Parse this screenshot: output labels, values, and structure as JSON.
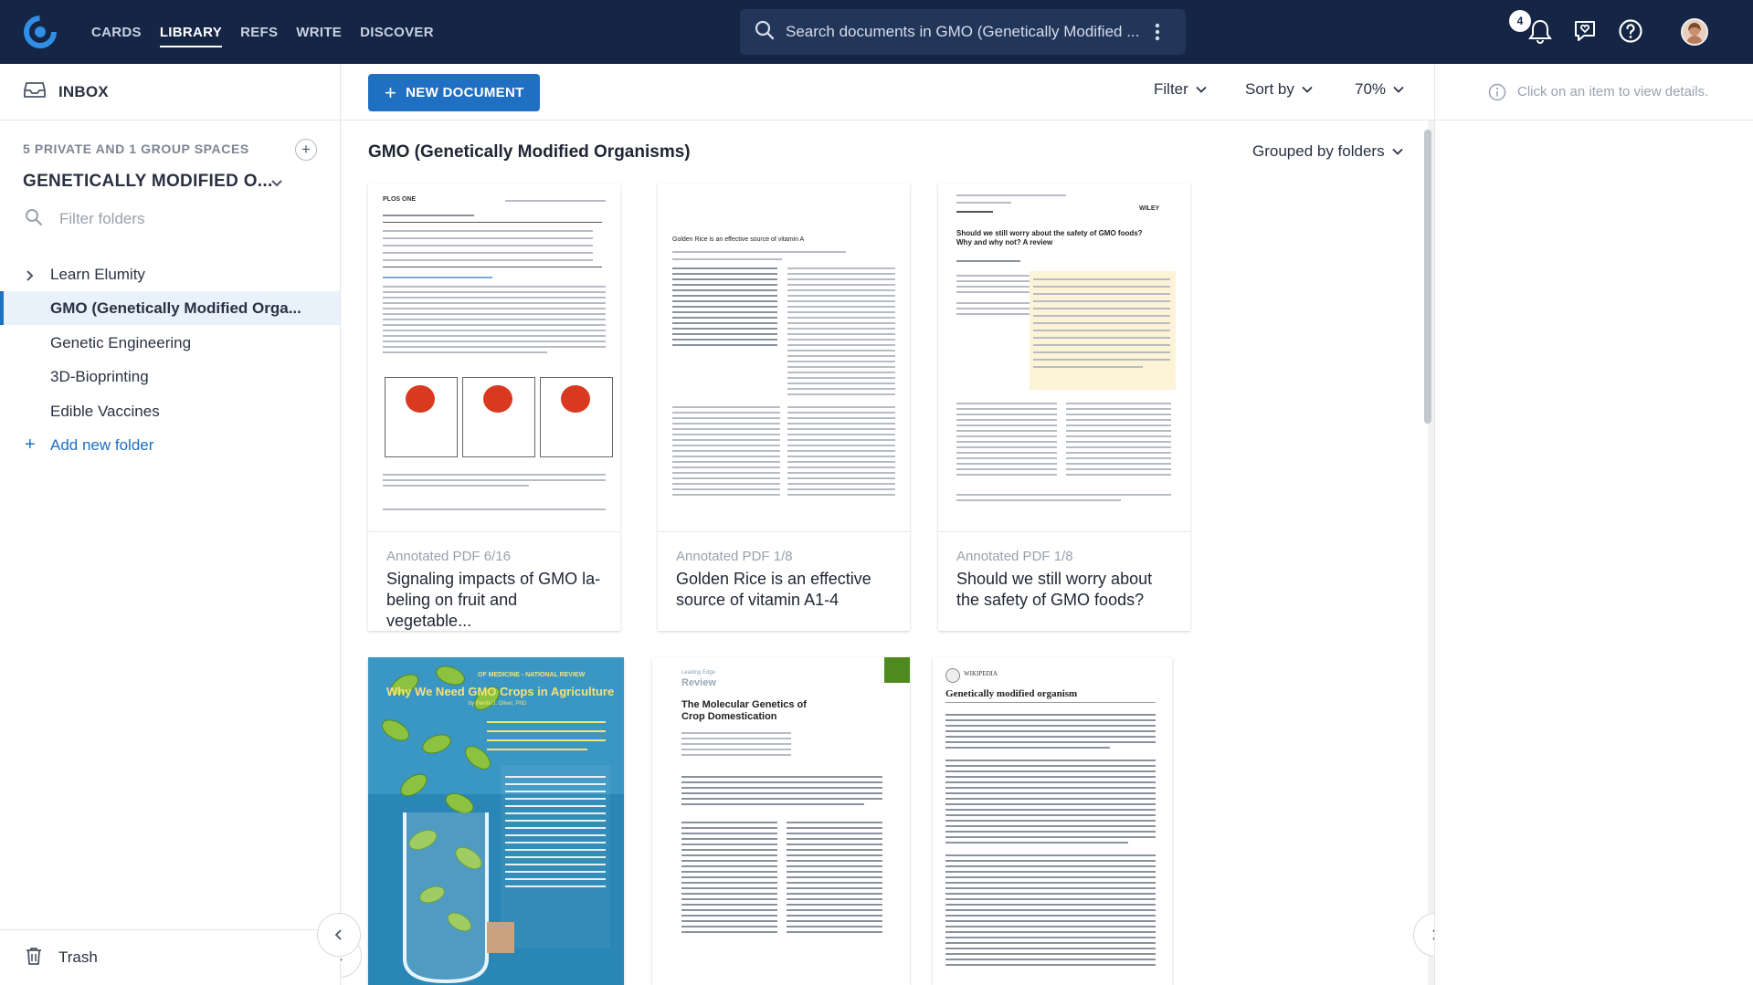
{
  "topbar": {
    "nav": [
      {
        "label": "CARDS",
        "active": false
      },
      {
        "label": "LIBRARY",
        "active": true
      },
      {
        "label": "REFS",
        "active": false
      },
      {
        "label": "WRITE",
        "active": false
      },
      {
        "label": "DISCOVER",
        "active": false
      }
    ],
    "search_placeholder": "Search documents in GMO (Genetically Modified ...",
    "notification_count": "4",
    "icons": [
      "logo-icon",
      "search-icon",
      "more-vertical-icon",
      "bell-icon",
      "chat-heart-icon",
      "help-icon",
      "avatar"
    ]
  },
  "sidebar": {
    "inbox_label": "INBOX",
    "spaces_heading": "5 PRIVATE AND 1 GROUP SPACES",
    "space_title": "GENETICALLY MODIFIED O...",
    "filter_placeholder": "Filter folders",
    "folders": [
      {
        "label": "Learn Elumity",
        "expandable": true,
        "selected": false
      },
      {
        "label": "GMO (Genetically Modified Orga...",
        "expandable": false,
        "selected": true
      },
      {
        "label": "Genetic Engineering",
        "expandable": false,
        "selected": false
      },
      {
        "label": "3D-Bioprinting",
        "expandable": false,
        "selected": false
      },
      {
        "label": "Edible Vaccines",
        "expandable": false,
        "selected": false
      }
    ],
    "add_folder_label": "Add new folder",
    "trash_label": "Trash"
  },
  "toolbar": {
    "new_document_label": "NEW DOCUMENT",
    "filter_label": "Filter",
    "sort_label": "Sort by",
    "zoom_label": "70%"
  },
  "main": {
    "section_title": "GMO (Genetically Modified Organisms)",
    "grouping_label": "Grouped by folders",
    "cards": [
      {
        "meta": "Annotated PDF   6/16",
        "title": "Signaling impacts of GMO la-beling on fruit and vegetable...",
        "journal": "PLOS ONE"
      },
      {
        "meta": "Annotated PDF   1/8",
        "title": "Golden Rice is an effective source of vitamin A1-4",
        "journal": "Golden Rice is an effective source of vitamin A"
      },
      {
        "meta": "Annotated PDF   1/8",
        "title": "Should we still worry about the safety of GMO foods?",
        "journal": "Should we still worry about the safety of GMO foods? Why and why not? A review"
      }
    ],
    "second_row": [
      {
        "heading": "Why We Need GMO Crops in Agriculture",
        "kicker": "OF MEDICINE - NATIONAL REVIEW",
        "byline": "by Martin J. Oliver, PhD"
      },
      {
        "kicker": "Leading Edge",
        "section": "Review",
        "heading": "The Molecular Genetics of Crop Domestication"
      },
      {
        "brand": "WIKIPEDIA",
        "heading": "Genetically modified organism"
      }
    ]
  },
  "right_panel": {
    "hint": "Click on an item to view details."
  },
  "colors": {
    "topbar": "#142545",
    "accent": "#1f6fc2",
    "selected_bg": "#e9f1fb"
  }
}
